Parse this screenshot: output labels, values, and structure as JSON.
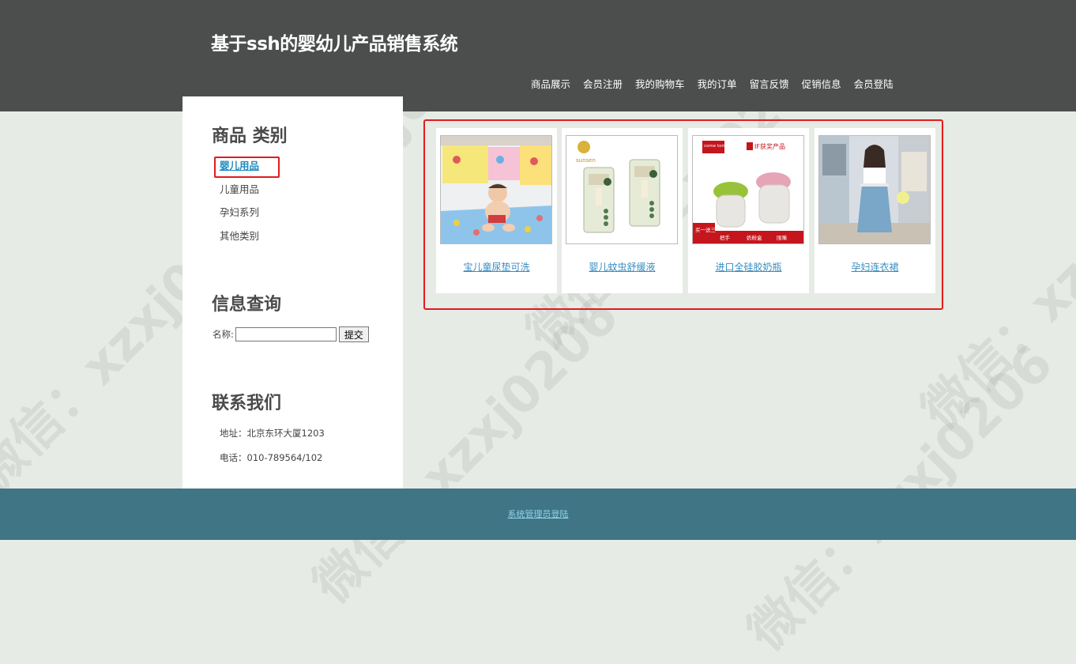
{
  "header": {
    "title": "基于ssh的婴幼儿产品销售系统",
    "nav": [
      "商品展示",
      "会员注册",
      "我的购物车",
      "我的订单",
      "留言反馈",
      "促销信息",
      "会员登陆"
    ]
  },
  "sidebar": {
    "category_heading": "商品 类别",
    "categories": [
      "婴儿用品",
      "儿童用品",
      "孕妇系列",
      "其他类别"
    ],
    "search_heading": "信息查询",
    "search_label": "名称:",
    "search_value": "",
    "search_button": "提交",
    "contact_heading": "联系我们",
    "address": "地址：北京东环大厦1203",
    "phone": "电话：010-789564/102"
  },
  "products": [
    {
      "name": "宝儿童尿垫可洗"
    },
    {
      "name": "婴儿蚊虫舒缓液"
    },
    {
      "name": "进口全硅胶奶瓶"
    },
    {
      "name": "孕妇连衣裙"
    }
  ],
  "product_image_text": {
    "p2_brand": "sunsen",
    "p3_brand": "come tomo",
    "p3_badge": "IF获奖产品",
    "p3_bottom": [
      "买一送三",
      "把手",
      "奶粉盒",
      "围嘴"
    ]
  },
  "watermark": "微信：xzxj0206",
  "footer": {
    "admin_link": "系统管理员登陆"
  },
  "colors": {
    "header_bg": "#4b4e4d",
    "page_bg": "#e6ebe5",
    "footer_bg": "#3f7585",
    "highlight": "#e21b1b",
    "link": "#3a8ec0"
  }
}
